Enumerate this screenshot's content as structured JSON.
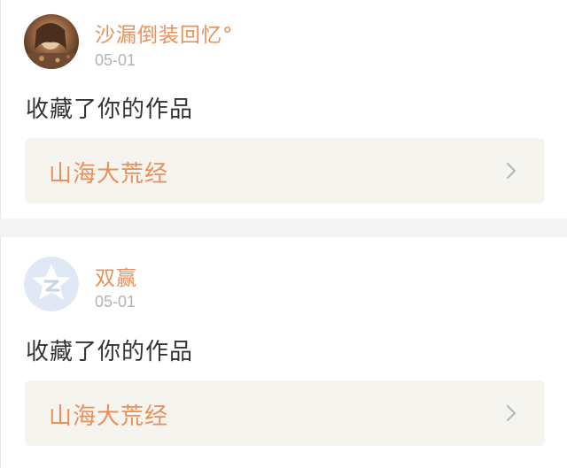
{
  "notifications": [
    {
      "username": "沙漏倒装回忆°",
      "date": "05-01",
      "action_text": "收藏了你的作品",
      "work_title": "山海大荒经",
      "avatar_icon": "photo-avatar-icon"
    },
    {
      "username": "双赢",
      "date": "05-01",
      "action_text": "收藏了你的作品",
      "work_title": "山海大荒经",
      "avatar_icon": "default-star-avatar-icon"
    }
  ],
  "colors": {
    "accent": "#e8905a",
    "work_box_bg": "#f6f4ef",
    "date_text": "#b4b4b4",
    "body_text": "#333333"
  }
}
